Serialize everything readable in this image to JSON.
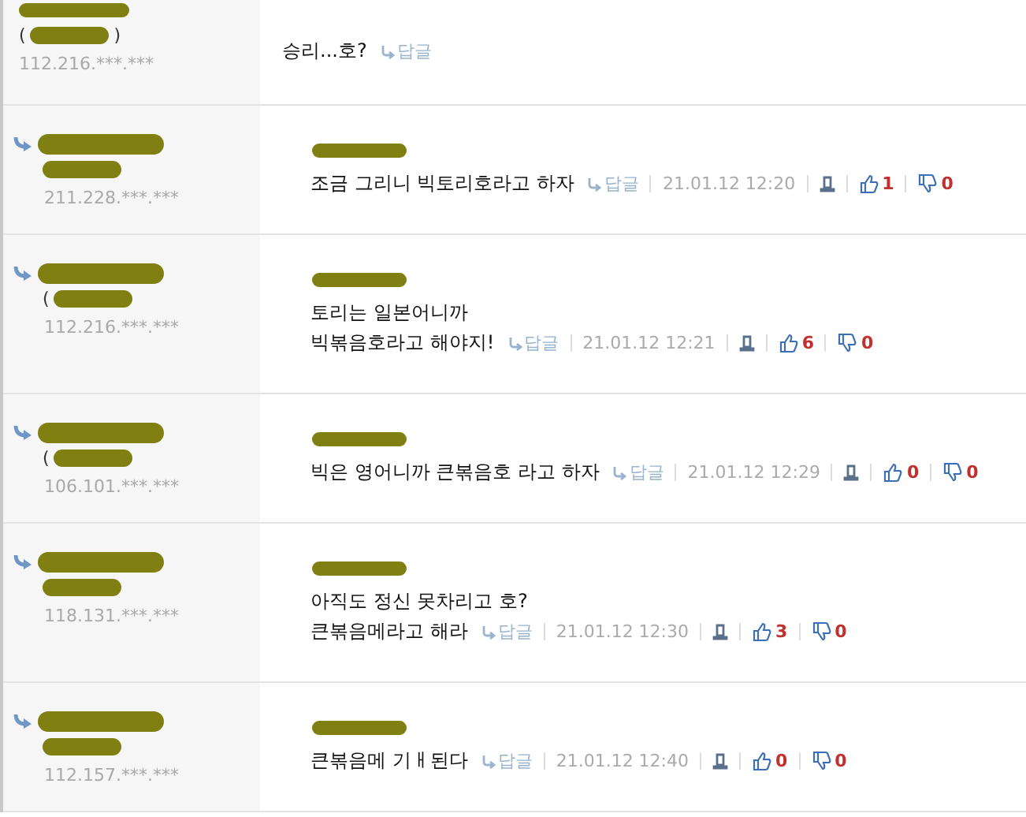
{
  "comments": [
    {
      "kind": "root",
      "paren_open": "(",
      "paren_close": ")",
      "ip": "112.216.***.***",
      "lines": [
        "승리...호?"
      ],
      "reply": "답글"
    },
    {
      "kind": "reply",
      "ip": "211.228.***.***",
      "lines": [
        "조금 그리니 빅토리호라고 하자"
      ],
      "reply": "답글",
      "date": "21.01.12 12:20",
      "likes": "1",
      "dislikes": "0"
    },
    {
      "kind": "reply",
      "paren_open": "(",
      "ip": "112.216.***.***",
      "lines": [
        "토리는 일본어니까",
        "빅볶음호라고 해야지!"
      ],
      "reply": "답글",
      "date": "21.01.12 12:21",
      "likes": "6",
      "dislikes": "0"
    },
    {
      "kind": "reply",
      "paren_open": "(",
      "ip": "106.101.***.***",
      "lines": [
        "빅은 영어니까 큰볶음호 라고 하자"
      ],
      "reply": "답글",
      "date": "21.01.12 12:29",
      "likes": "0",
      "dislikes": "0"
    },
    {
      "kind": "reply",
      "ip": "118.131.***.***",
      "lines": [
        "아직도 정신 못차리고 호?",
        "큰볶음메라고 해라"
      ],
      "reply": "답글",
      "date": "21.01.12 12:30",
      "likes": "3",
      "dislikes": "0"
    },
    {
      "kind": "reply",
      "ip": "112.157.***.***",
      "lines": [
        "큰볶음메 기ㅐ된다"
      ],
      "reply": "답글",
      "date": "21.01.12 12:40",
      "likes": "0",
      "dislikes": "0"
    }
  ]
}
